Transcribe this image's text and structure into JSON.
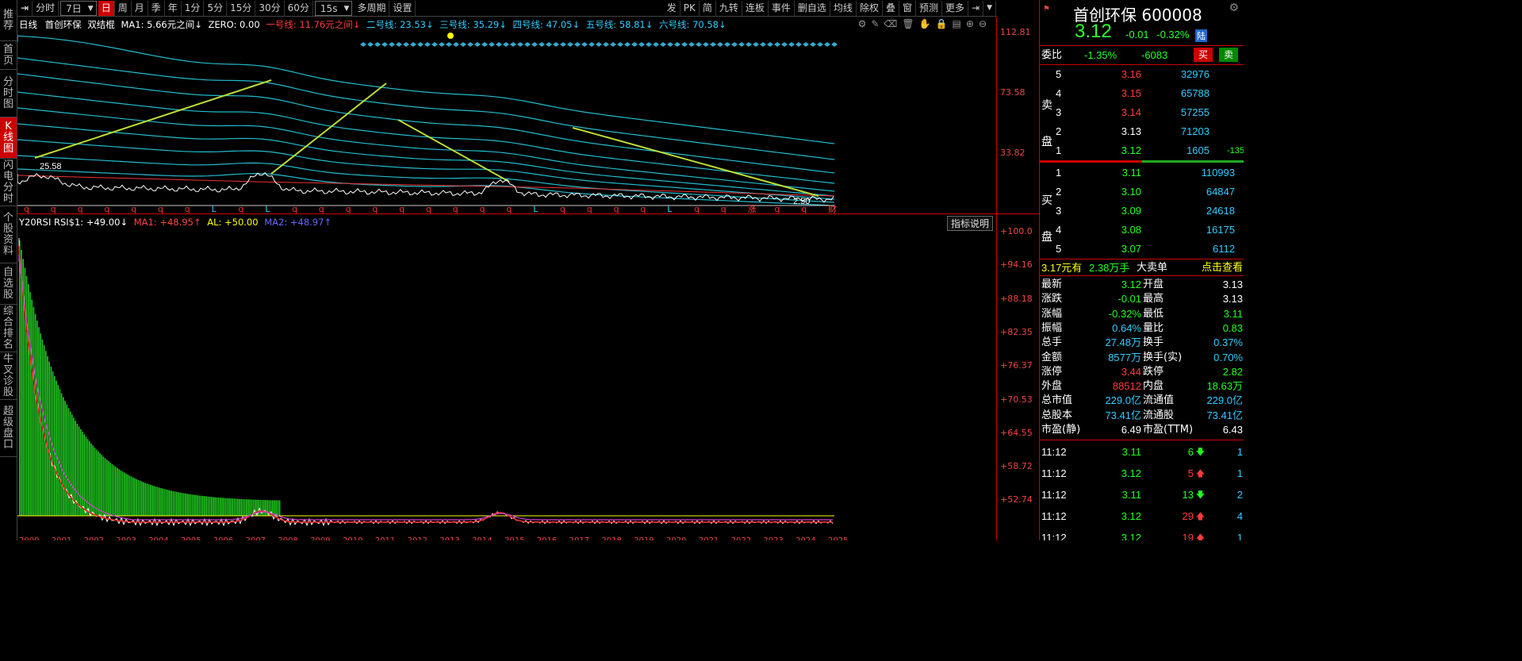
{
  "left_nav": [
    "推荐",
    "首页",
    "分时图",
    "K线图",
    "闪电分时",
    "个股资料",
    "自选股",
    "综合排名",
    "牛叉诊股",
    "超级盘口"
  ],
  "toolbar": {
    "periods": [
      "分时",
      "7日",
      "日",
      "周",
      "月",
      "季",
      "年",
      "1分",
      "5分",
      "15分",
      "30分",
      "60分"
    ],
    "period_active": "日",
    "interval_select": "15s",
    "multi_period": "多周期",
    "settings": "设置",
    "right_items": [
      "发",
      "PK",
      "简",
      "九转",
      "连板",
      "事件",
      "删自选",
      "均线",
      "除权",
      "叠",
      "窗",
      "预测",
      "更多"
    ]
  },
  "kline": {
    "header": {
      "period": "日线",
      "name": "首创环保",
      "indicator": "双结棍",
      "ma1": "MA1: 5.66元之间↓",
      "zero": "ZERO: 0.00",
      "line1": "一号线: 11.76元之间↓",
      "line2": "二号线: 23.53↓",
      "line3": "三号线: 35.29↓",
      "line4": "四号线: 47.05↓",
      "line5": "五号线: 58.81↓",
      "line6": "六号线: 70.58↓"
    },
    "y_ticks": [
      "112.81",
      "73.58",
      "33.82"
    ],
    "high_label": "25.58",
    "low_label": "2.50",
    "event_markers": [
      "q",
      "q",
      "q",
      "q",
      "q",
      "q",
      "q",
      "L",
      "q",
      "L",
      "q",
      "q",
      "q",
      "q",
      "q",
      "q",
      "q",
      "q",
      "q",
      "L",
      "q",
      "q",
      "q",
      "q",
      "L",
      "q",
      "q",
      "涨",
      "q",
      "q",
      "财"
    ]
  },
  "indicator": {
    "header": {
      "name": "Y20RSI RSI$1: +49.00↓",
      "ma1": "MA1: +48.95↑",
      "al": "AL: +50.00",
      "ma2": "MA2: +48.97↑"
    },
    "button": "指标说明",
    "y_ticks": [
      "+100.0",
      "+94.16",
      "+88.18",
      "+82.35",
      "+76.37",
      "+70.53",
      "+64.55",
      "+58.72",
      "+52.74"
    ]
  },
  "x_axis_years": [
    "2000",
    "2001",
    "2002",
    "2003",
    "2004",
    "2005",
    "2006",
    "2007",
    "2008",
    "2009",
    "2010",
    "2011",
    "2012",
    "2013",
    "2014",
    "2015",
    "2016",
    "2017",
    "2018",
    "2019",
    "2020",
    "2021",
    "2022",
    "2023",
    "2024",
    "2025"
  ],
  "quote": {
    "name": "首创环保",
    "code": "600008",
    "price": "3.12",
    "change": "-0.01",
    "change_pct": "-0.32%",
    "market_tag": "陆",
    "weibi_label": "委比",
    "weibi_pct": "-1.35%",
    "weibi_diff": "-6083",
    "buy_btn": "买",
    "sell_btn": "卖",
    "sell_label": "卖盘",
    "buy_label": "买盘",
    "asks": [
      {
        "level": "5",
        "price": "3.16",
        "vol": "32976",
        "extra": ""
      },
      {
        "level": "4",
        "price": "3.15",
        "vol": "65788",
        "extra": ""
      },
      {
        "level": "3",
        "price": "3.14",
        "vol": "57255",
        "extra": ""
      },
      {
        "level": "2",
        "price": "3.13",
        "vol": "71203",
        "extra": ""
      },
      {
        "level": "1",
        "price": "3.12",
        "vol": "1605",
        "extra": "-135"
      }
    ],
    "bids": [
      {
        "level": "1",
        "price": "3.11",
        "vol": "110993"
      },
      {
        "level": "2",
        "price": "3.10",
        "vol": "64847"
      },
      {
        "level": "3",
        "price": "3.09",
        "vol": "24618"
      },
      {
        "level": "4",
        "price": "3.08",
        "vol": "16175"
      },
      {
        "level": "5",
        "price": "3.07",
        "vol": "6112"
      }
    ],
    "bigorder": {
      "price": "3.17元有",
      "vol": "2.38万手",
      "label": "大卖单",
      "link": "点击查看"
    },
    "stats": [
      [
        "最新",
        "3.12",
        "开盘",
        "3.13"
      ],
      [
        "涨跌",
        "-0.01",
        "最高",
        "3.13"
      ],
      [
        "涨幅",
        "-0.32%",
        "最低",
        "3.11"
      ],
      [
        "振幅",
        "0.64%",
        "量比",
        "0.83"
      ],
      [
        "总手",
        "27.48万",
        "换手",
        "0.37%"
      ],
      [
        "金额",
        "8577万",
        "换手(实)",
        "0.70%"
      ],
      [
        "涨停",
        "3.44",
        "跌停",
        "2.82"
      ],
      [
        "外盘",
        "88512",
        "内盘",
        "18.63万"
      ],
      [
        "总市值",
        "229.0亿",
        "流通值",
        "229.0亿"
      ],
      [
        "总股本",
        "73.41亿",
        "流通股",
        "73.41亿"
      ],
      [
        "市盈(静)",
        "6.49",
        "市盈(TTM)",
        "6.43"
      ]
    ],
    "ticks": [
      {
        "time": "11:12",
        "price": "3.11",
        "vol": "6",
        "dir": "down",
        "n": "1"
      },
      {
        "time": "11:12",
        "price": "3.12",
        "vol": "5",
        "dir": "up",
        "n": "1"
      },
      {
        "time": "11:12",
        "price": "3.11",
        "vol": "13",
        "dir": "down",
        "n": "2"
      },
      {
        "time": "11:12",
        "price": "3.12",
        "vol": "29",
        "dir": "up",
        "n": "4"
      },
      {
        "time": "11:12",
        "price": "3.12",
        "vol": "19",
        "dir": "up",
        "n": "1"
      }
    ]
  }
}
